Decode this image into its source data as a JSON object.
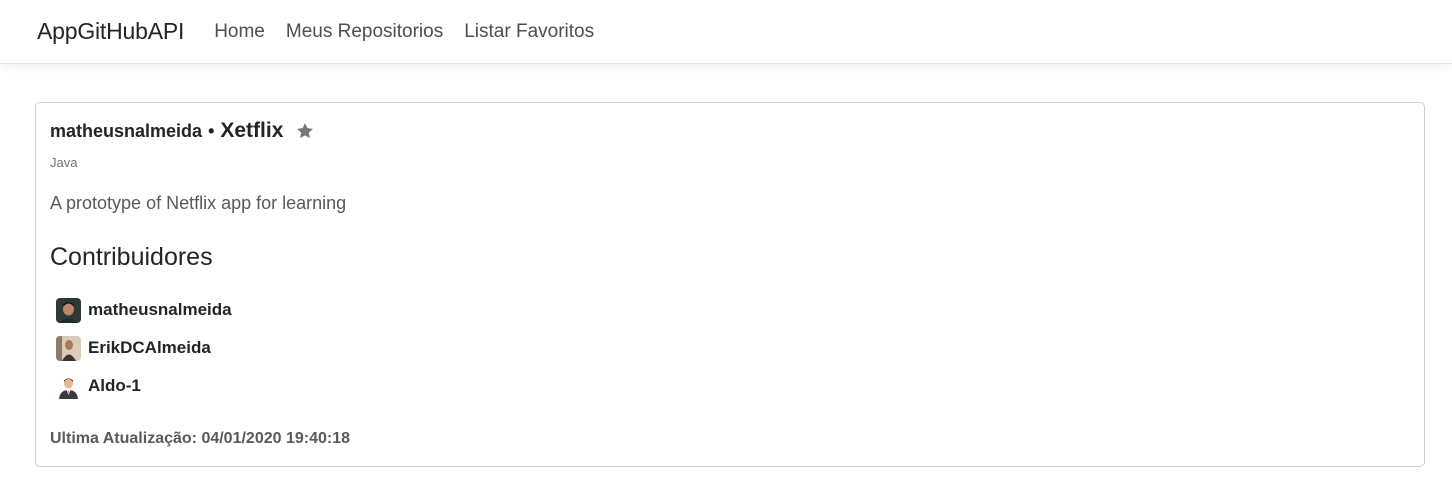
{
  "navbar": {
    "brand": "AppGitHubAPI",
    "links": [
      {
        "label": "Home"
      },
      {
        "label": "Meus Repositorios"
      },
      {
        "label": "Listar Favoritos"
      }
    ]
  },
  "repo": {
    "owner": "matheusnalmeida",
    "separator": "•",
    "name": "Xetflix",
    "star_icon": "star-icon",
    "language": "Java",
    "description": "A prototype of Netflix app for learning"
  },
  "contributors": {
    "title": "Contribuidores",
    "items": [
      {
        "name": "matheusnalmeida",
        "avatar": "avatar-photo"
      },
      {
        "name": "ErikDCAlmeida",
        "avatar": "avatar-photo"
      },
      {
        "name": "Aldo-1",
        "avatar": "avatar-default-person"
      }
    ]
  },
  "updated": {
    "label": "Ultima Atualização: 04/01/2020 19:40:18"
  },
  "colors": {
    "star": "#777777",
    "border": "#cfcfcf"
  }
}
